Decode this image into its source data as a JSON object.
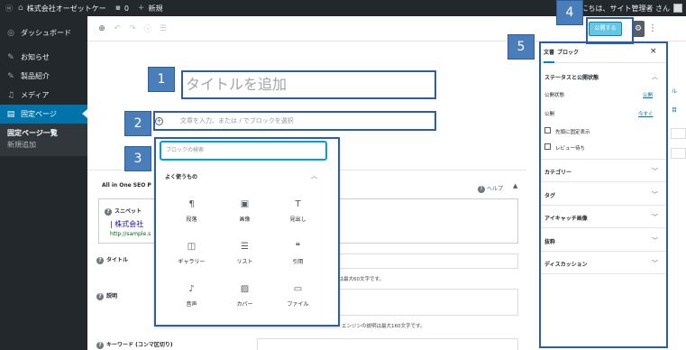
{
  "adminbar": {
    "site_name": "株式会社オーゼットケー",
    "comments_count": "0",
    "new_label": "新規",
    "greeting": "こんにちは、サイト管理者 さん"
  },
  "sidebar": {
    "items": [
      {
        "label": "ダッシュボード",
        "icon": "dashboard-icon"
      },
      {
        "label": "お知らせ",
        "icon": "pin-icon"
      },
      {
        "label": "製品紹介",
        "icon": "pin-icon"
      },
      {
        "label": "メディア",
        "icon": "media-icon"
      },
      {
        "label": "固定ページ",
        "icon": "pages-icon"
      }
    ],
    "submenu": [
      "固定ページ一覧",
      "新規追加"
    ]
  },
  "toolbar": {
    "publish_label": "公開する"
  },
  "editor": {
    "title_placeholder": "タイトルを追加",
    "block_placeholder": "文章を入力、または / でブロックを選択"
  },
  "callouts": [
    "1",
    "2",
    "3",
    "4",
    "5"
  ],
  "inserter": {
    "search_placeholder": "ブロックの検索",
    "section_title": "よく使うもの",
    "blocks": [
      {
        "label": "段落",
        "icon": "¶",
        "name": "paragraph-block-icon"
      },
      {
        "label": "画像",
        "icon": "▣",
        "name": "image-block-icon"
      },
      {
        "label": "見出し",
        "icon": "T",
        "name": "heading-block-icon"
      },
      {
        "label": "ギャラリー",
        "icon": "◫",
        "name": "gallery-block-icon"
      },
      {
        "label": "リスト",
        "icon": "☰",
        "name": "list-block-icon"
      },
      {
        "label": "引用",
        "icon": "❝",
        "name": "quote-block-icon"
      },
      {
        "label": "音声",
        "icon": "♪",
        "name": "audio-block-icon"
      },
      {
        "label": "カバー",
        "icon": "▨",
        "name": "cover-block-icon"
      },
      {
        "label": "ファイル",
        "icon": "▭",
        "name": "file-block-icon"
      }
    ]
  },
  "seo": {
    "box_title": "All in One SEO P",
    "help_label": "ヘルプ",
    "snippet_label": "スニペット",
    "snippet_title": "| 株式会社",
    "snippet_url": "http://sample.s",
    "title_label": "タイトル",
    "title_note": "検索エンジンのタイトルは最大60文字です。",
    "description_label": "説明",
    "description_note": "エンジンの説明は最大160文字です。",
    "keywords_label": "キーワード (コンマ区切り)"
  },
  "settings": {
    "tab_document": "文書",
    "tab_block": "ブロック",
    "status_heading": "ステータスと公開状態",
    "visibility_label": "公開状態",
    "visibility_value": "公開",
    "publish_label": "公開",
    "publish_value": "今すぐ",
    "sticky_label": "先頭に固定表示",
    "review_label": "レビュー待ち",
    "panels": [
      "カテゴリー",
      "タグ",
      "アイキャッチ画像",
      "抜粋",
      "ディスカッション"
    ]
  },
  "edge": {
    "text1": "ル",
    "text2": "目"
  },
  "colors": {
    "admin_bg": "#23282d",
    "accent": "#0073aa",
    "callout": "#4a7ebb",
    "outline": "#2d5ea5"
  }
}
